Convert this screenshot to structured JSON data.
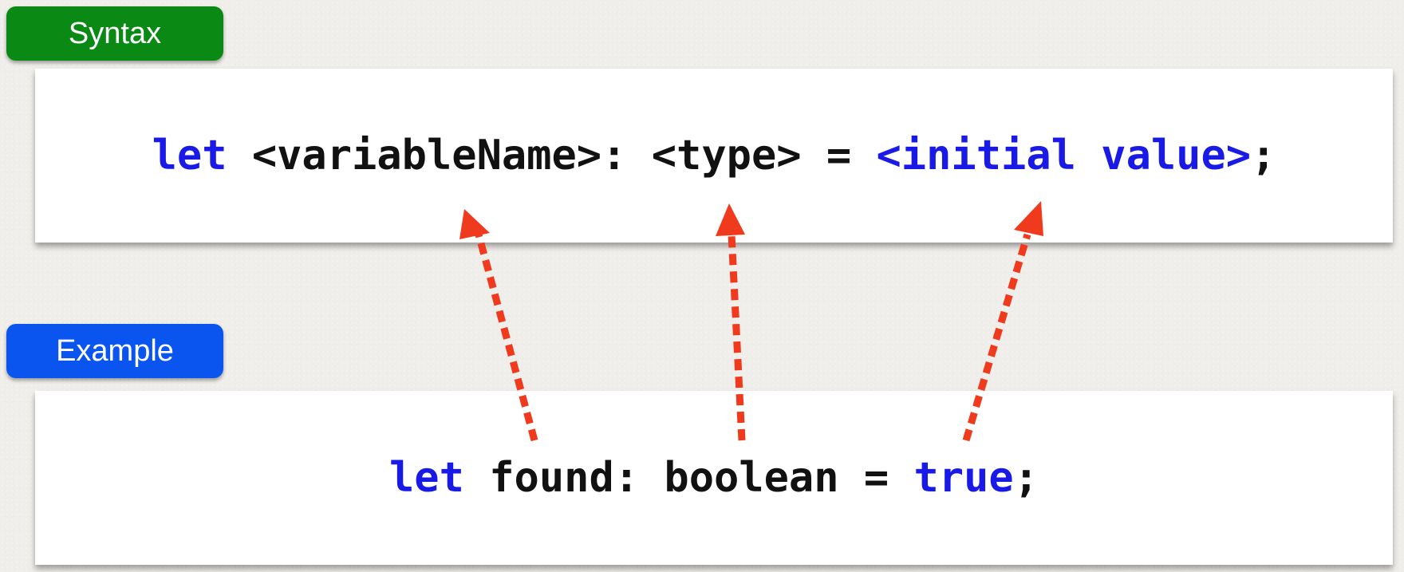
{
  "labels": {
    "syntax": "Syntax",
    "example": "Example"
  },
  "syntax_line": {
    "keyword": "let",
    "space1": " ",
    "variable_name": "<variableName>",
    "colon": ": ",
    "type": "<type>",
    "equals": " = ",
    "initial_value": "<initial value>",
    "semicolon": ";"
  },
  "example_line": {
    "keyword": "let",
    "space1": " ",
    "variable_name": "found",
    "colon": ": ",
    "type": "boolean",
    "equals": " = ",
    "value": "true",
    "semicolon": ";"
  },
  "colors": {
    "syntax_badge": "#0a8a14",
    "example_badge": "#0a55f0",
    "keyword": "#1a1ae6",
    "arrow": "#f03a1e"
  }
}
